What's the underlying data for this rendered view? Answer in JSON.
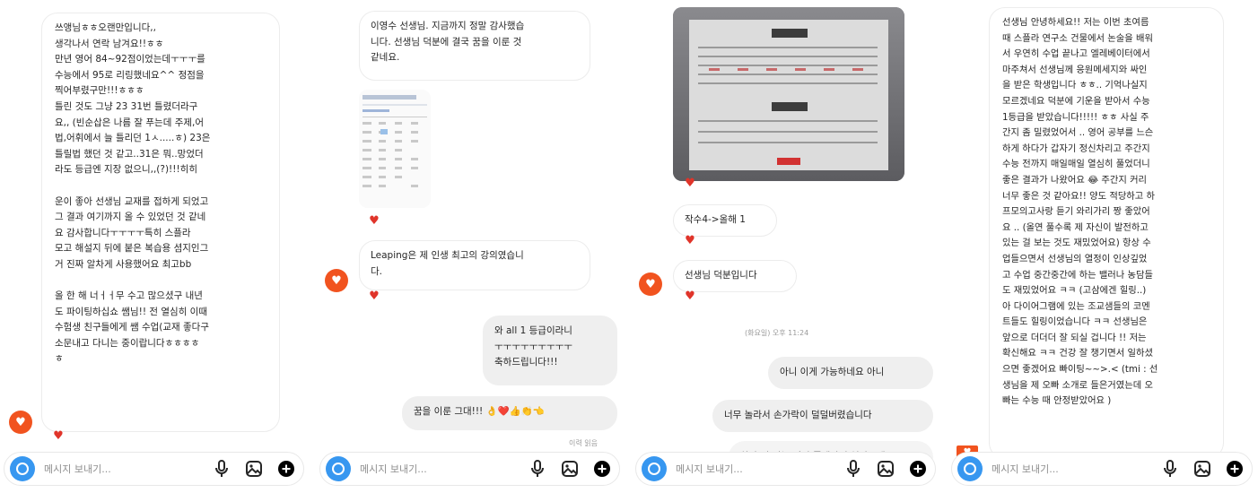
{
  "composer": {
    "placeholder": "메시지 보내기..."
  },
  "panel1": {
    "message": "쓰앵님ㅎㅎ오랜만입니다,,\n생각나서 연락 남겨요!!ㅎㅎ\n만년 영어 84~92점이었는데ㅜㅜㅜ를\n수능에서 95로 리링했네요^^ 정점을\n찍어부렸구만!!!ㅎㅎㅎ\n틀린 것도 그냥 23 31번 틀렸더라구\n요,, (빈순삽은 나름 잘 푸는데 주제,어\n법,어휘에서 늘 틀리던 1ㅅ.....ㅎ) 23은\n틀릴법 했던 것 같고..31은 뭐..망었더\n라도 등급엔 지장 없으니,,(?)!!!히히\n\n운이 좋아 선생님 교재를 접하게 되었고\n그 결과 여기까지 올 수 있었던 것 같네\n요 감사합니다ㅜㅜㅜㅜ특히 스플라\n모고 해설지 뒤에 붙은 복습용 셤지인그\n거 진짜 알차게 사용했어요 최고bb\n\n올 한 해 너ㅓㅓ무 수고 많으셨구 내년\n도 파이팅하십쇼 쌤님!! 전 열심히 이때\n수험생 친구들에게 쌤 수업(교재 좋다구\n소문내고 다니는 중이랍니다ㅎㅎㅎㅎ\nㅎ"
  },
  "panel2": {
    "msg1": "이영수 선생님. 지금까지 정말 감사했습\n니다. 선생님 덕분에 결국 꿈을 이룬 것\n같네요.",
    "msg2": "Leaping은 제 인생 최고의 강의였습니\n다.",
    "msg3": "와 all 1 등급이라니\nㅜㅜㅜㅜㅜㅜㅜㅜㅜ\n축하드립니다!!!",
    "msg4": "꿈을 이룬 그대!!! 👌❤️👍👏👈",
    "time": "이력 읽음"
  },
  "panel3": {
    "msg1": "작수4->올해 1",
    "msg2": "선생님 덕분입니다",
    "time": "(화요일) 오후 11:24",
    "msg3": "아니 이게 가능하네요 아니",
    "msg4": "너무 놀라서 손가락이 덜덜버렸습니다",
    "msg5": "하나 더 있는 것이 좋겠다면 연락주세요"
  },
  "panel4": {
    "message": "선생님 안녕하세요!! 저는 이번 초여름\n때 스플라 연구소 건물에서 논술을 배워\n서 우연히 수업 끝나고 엘레베이터에서\n마주쳐서 선생님께 응원메세지와 싸인\n을 받은 학생입니다 ㅎㅎ.. 기억나실지\n모르겠네요 덕분에 기운을 받아서 수능\n1등급을 받았습니다!!!!! ㅎㅎ 사실 주\n간지 좀 밀렸었어서 .. 영어 공부를 느슨\n하게 하다가 갑자기 정신차리고 주간지\n수능 전까지 매일매일 열심히 풀었더니\n좋은 결과가 나왔어요 😂 주간지 커리\n너무 좋은 것 같아요!! 양도 적당하고 하\n프모의고사랑 듣기 와리가리 짱 좋았어\n요 .. (올연 풀수록 제 자신이 발전하고\n있는 걸 보는 것도 재밌었어요) 항상 수\n업들으면서 선생님의 열정이 인상깊었\n고 수업 중간중간에 하는 밸러나 농담들\n도 재밌었어요 ㅋㅋ (고삼에겐 힐링..)\n아 다이어그램에 있는 조교샘들의 코멘\n트들도 힐링이었습니다 ㅋㅋ 선생님은\n앞으로 더더더 잘 되실 겁니다 !! 저는\n확신해요 ㅋㅋ 건강 잘 챙기면서 일하셨\n으면 좋겠어요 빠이팅~~>.< (tmi : 선\n생님을 제 오빠 소개로 들은거였는데 오\n빠는 수능 때 안정받았어요 )"
  }
}
